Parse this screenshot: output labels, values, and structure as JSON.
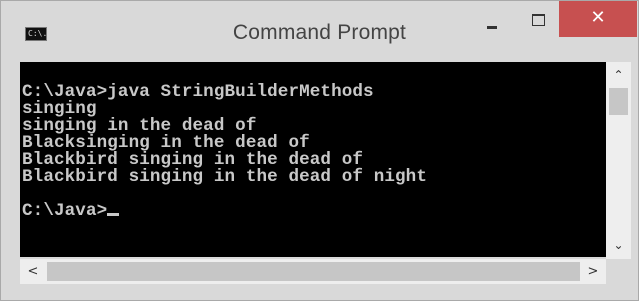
{
  "window": {
    "title": "Command Prompt",
    "app_icon_text": "C:\\.",
    "controls": {
      "minimize": "minimize",
      "maximize": "maximize",
      "close": "✕"
    }
  },
  "console": {
    "lines": [
      "C:\\Java>java StringBuilderMethods",
      "singing",
      "singing in the dead of",
      "Blacksinging in the dead of",
      "Blackbird singing in the dead of",
      "Blackbird singing in the dead of night",
      "",
      "C:\\Java>"
    ],
    "colors": {
      "background": "#000000",
      "text": "#c8c8c8"
    }
  },
  "scrollbars": {
    "vertical": {
      "up": "⌃",
      "down": "⌄"
    },
    "horizontal": {
      "left": "<",
      "right": ">"
    }
  }
}
